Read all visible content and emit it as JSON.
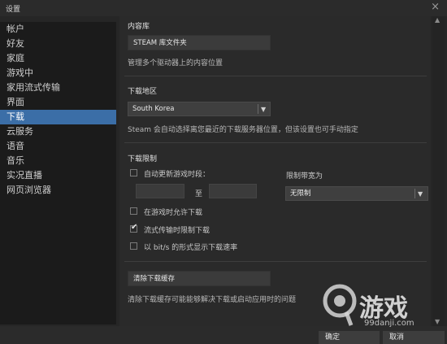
{
  "window": {
    "title": "设置",
    "close_glyph": "×"
  },
  "sidebar": {
    "items": [
      {
        "label": "帐户"
      },
      {
        "label": "好友"
      },
      {
        "label": "家庭"
      },
      {
        "label": "游戏中"
      },
      {
        "label": "家用流式传输"
      },
      {
        "label": "界面"
      },
      {
        "label": "下载"
      },
      {
        "label": "云服务"
      },
      {
        "label": "语音"
      },
      {
        "label": "音乐"
      },
      {
        "label": "实况直播"
      },
      {
        "label": "网页浏览器"
      }
    ],
    "active_index": 6
  },
  "library": {
    "heading": "内容库",
    "button_label": "STEAM 库文件夹",
    "description": "管理多个驱动器上的内容位置"
  },
  "region": {
    "heading": "下载地区",
    "selected": "South Korea",
    "description": "Steam 会自动选择离您最近的下载服务器位置，但该设置也可手动指定"
  },
  "limits": {
    "heading": "下载限制",
    "auto_update_label": "自动更新游戏时段：",
    "to_label": "至",
    "bandwidth_label": "限制带宽为",
    "bandwidth_value": "无限制",
    "allow_ingame_label": "在游戏时允许下载",
    "allow_ingame_checked": false,
    "throttle_stream_label": "流式传输时限制下载",
    "throttle_stream_checked": true,
    "bits_label": "以 bit/s 的形式显示下载速率",
    "bits_checked": false,
    "check_mark": "✔"
  },
  "cache": {
    "button_label": "清除下载缓存",
    "description": "清除下载缓存可能能够解决下载或启动应用时的问题"
  },
  "footer": {
    "ok_label": "确定",
    "cancel_label": "取消"
  },
  "watermark": {
    "text": "游戏",
    "url": "99danji.com"
  },
  "icons": {
    "dropdown_arrow": "dropdown-arrow-icon",
    "scroll_up": "scroll-up-icon",
    "scroll_down": "scroll-down-icon"
  },
  "colors": {
    "accent": "#3b6ea7",
    "background": "#262626",
    "panel": "#2a2a2a"
  }
}
